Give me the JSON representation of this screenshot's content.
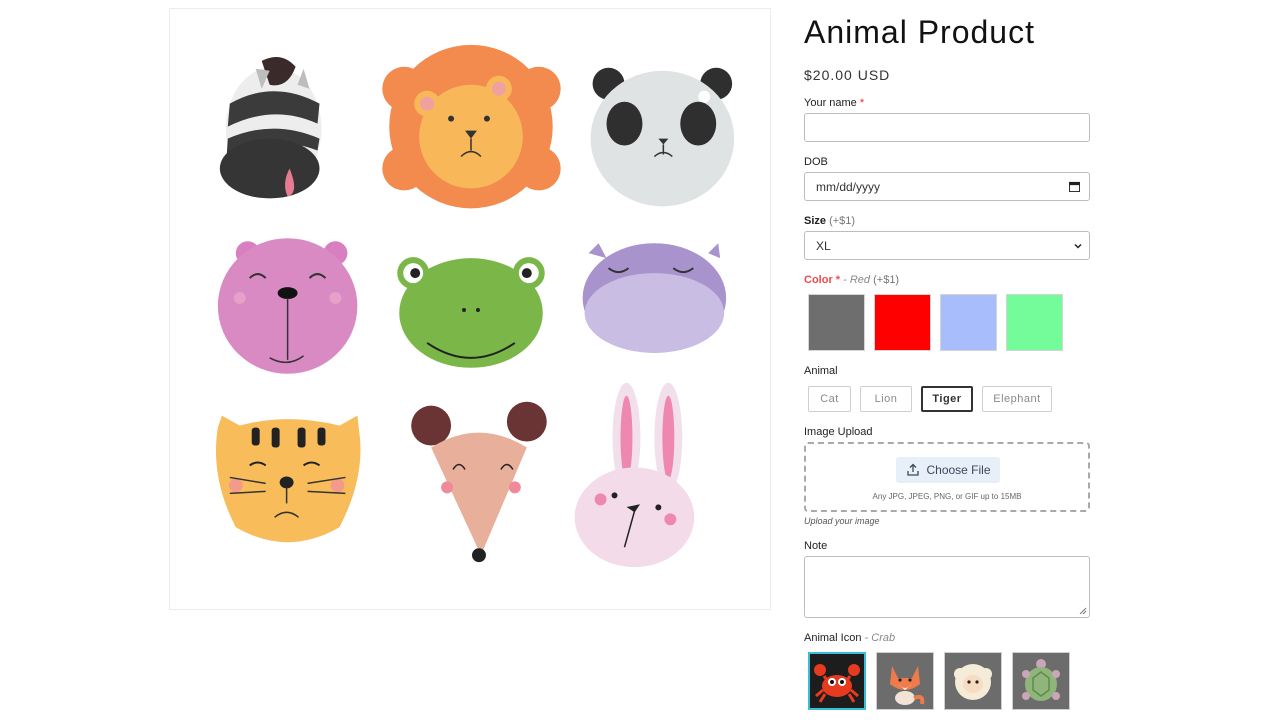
{
  "product": {
    "title": "Animal Product",
    "price": "$20.00 USD"
  },
  "fields": {
    "name": {
      "label": "Your name",
      "required": "*",
      "value": ""
    },
    "dob": {
      "label": "DOB",
      "placeholder": "mm/dd/yyyy"
    },
    "size": {
      "label": "Size",
      "surcharge": "(+$1)",
      "value": "XL"
    },
    "color": {
      "label": "Color",
      "required": "*",
      "selected": "- Red",
      "surcharge": "(+$1)",
      "swatches": [
        {
          "name": "gray",
          "hex": "#6e6e6e"
        },
        {
          "name": "red",
          "hex": "#ff0000"
        },
        {
          "name": "blue",
          "hex": "#a8bdfb"
        },
        {
          "name": "green",
          "hex": "#74fc9b"
        }
      ]
    },
    "animal": {
      "label": "Animal",
      "options": [
        "Cat",
        "Lion",
        "Tiger",
        "Elephant"
      ],
      "selected": "Tiger"
    },
    "upload": {
      "label": "Image Upload",
      "button": "Choose File",
      "hint": "Any JPG, JPEG, PNG, or GIF up to 15MB",
      "help": "Upload your image"
    },
    "note": {
      "label": "Note",
      "value": ""
    },
    "animal_icon": {
      "label": "Animal Icon",
      "selected": "- Crab",
      "icons": [
        "crab-icon",
        "fox-icon",
        "sheep-icon",
        "turtle-icon"
      ]
    }
  },
  "gallery": {
    "animals": [
      "zebra",
      "lion",
      "panda",
      "bear",
      "frog",
      "hippo",
      "tiger",
      "mouse",
      "rabbit"
    ]
  },
  "colors": {
    "accent_selected": "#3bbcd7",
    "required": "#ee2222",
    "color_label": "#ef4a4a"
  }
}
